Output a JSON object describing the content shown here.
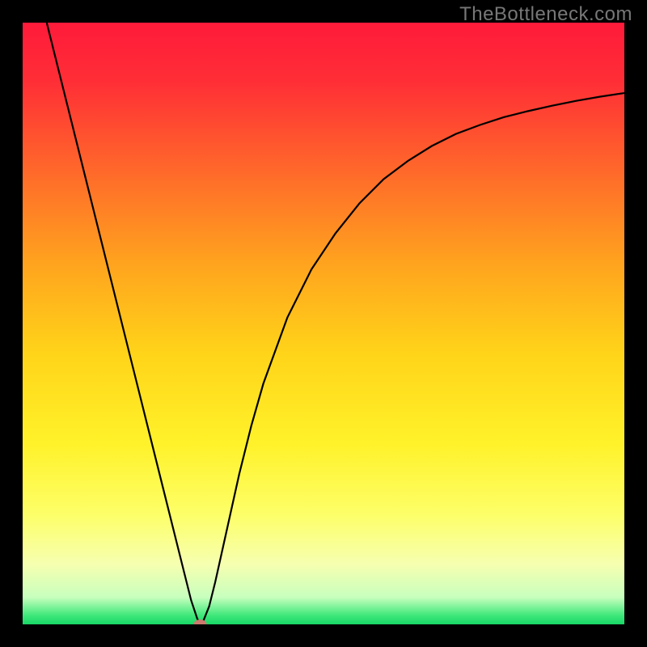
{
  "watermark": "TheBottleneck.com",
  "chart_data": {
    "type": "line",
    "title": "",
    "xlabel": "",
    "ylabel": "",
    "xlim": [
      0,
      100
    ],
    "ylim": [
      0,
      100
    ],
    "background_gradient": {
      "stops": [
        {
          "offset": 0.0,
          "color": "#ff1a3a"
        },
        {
          "offset": 0.1,
          "color": "#ff2f36"
        },
        {
          "offset": 0.25,
          "color": "#ff6a2a"
        },
        {
          "offset": 0.4,
          "color": "#ffa31e"
        },
        {
          "offset": 0.55,
          "color": "#ffd419"
        },
        {
          "offset": 0.7,
          "color": "#fff22a"
        },
        {
          "offset": 0.82,
          "color": "#fdff6a"
        },
        {
          "offset": 0.9,
          "color": "#f6ffb0"
        },
        {
          "offset": 0.955,
          "color": "#c8ffbe"
        },
        {
          "offset": 0.985,
          "color": "#3fe87a"
        },
        {
          "offset": 1.0,
          "color": "#18d666"
        }
      ]
    },
    "series": [
      {
        "name": "bottleneck-curve",
        "color": "#000000",
        "x": [
          4,
          6,
          8,
          10,
          12,
          14,
          16,
          18,
          20,
          22,
          24,
          26,
          27,
          28,
          29,
          29.5,
          30,
          31,
          32,
          34,
          36,
          38,
          40,
          44,
          48,
          52,
          56,
          60,
          64,
          68,
          72,
          76,
          80,
          84,
          88,
          92,
          96,
          100
        ],
        "y": [
          100,
          92,
          84,
          76,
          68,
          60,
          52,
          44,
          36,
          28,
          20,
          12,
          8,
          4,
          1,
          0,
          0.5,
          3,
          7,
          16,
          25,
          33,
          40,
          51,
          59,
          65,
          70,
          74,
          77,
          79.5,
          81.5,
          83,
          84.3,
          85.3,
          86.2,
          87,
          87.7,
          88.3
        ]
      }
    ],
    "marker": {
      "name": "optimal-point",
      "x": 29.5,
      "y": 0,
      "color": "#cc7a6e",
      "rx": 8,
      "ry": 6
    }
  }
}
